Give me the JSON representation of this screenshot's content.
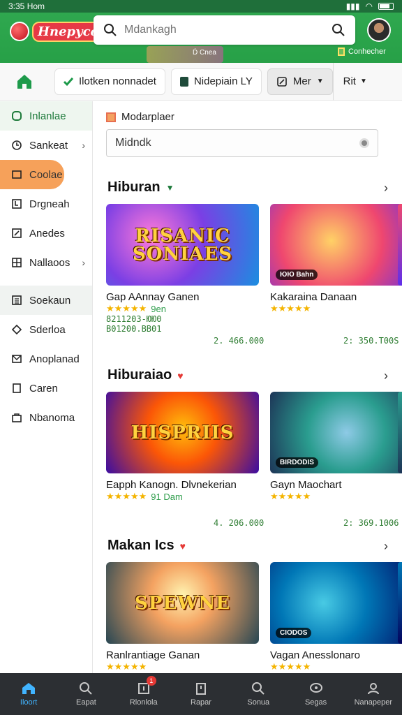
{
  "status_bar": {
    "time": "3:35 Hom"
  },
  "header": {
    "logo_text": "Hnepycop",
    "search_placeholder": "Mdankagh",
    "sub_left": "Ḋ Cnea",
    "sub_right": "Conhecher"
  },
  "topnav": {
    "pill1": "Ilotken nonnadet",
    "pill2": "Nidepiain  LY",
    "pill3": "Mer",
    "pill4": "Rit"
  },
  "sidebar": {
    "items": [
      {
        "label": "Inlanlae",
        "icon": "circle-icon",
        "state": "active"
      },
      {
        "label": "Sankeat",
        "icon": "clock-icon",
        "has_arrow": true
      },
      {
        "label": "Coolae",
        "icon": "box-icon",
        "state": "highlight"
      },
      {
        "label": "Drgneah",
        "icon": "arrow-box-icon"
      },
      {
        "label": "Anedes",
        "icon": "edit-icon"
      },
      {
        "label": "Nallaoos",
        "icon": "grid-icon",
        "has_arrow": true
      },
      {
        "label": "Soekaun",
        "icon": "list-icon",
        "state": "boxed"
      },
      {
        "label": "Sderloa",
        "icon": "tag-icon"
      },
      {
        "label": "Anoplanad",
        "icon": "mail-icon"
      },
      {
        "label": "Caren",
        "icon": "page-icon"
      },
      {
        "label": "Nbanoma",
        "icon": "bag-icon"
      }
    ]
  },
  "main": {
    "promo_label": "Modarplaer",
    "search_value": "Midndk",
    "sections": [
      {
        "title": "Hiburan",
        "cards": [
          {
            "thumb_text": "RISANIC SONIAES",
            "title": "Gap AAnnay Ganen",
            "stars": "★★★★★",
            "rating_text": "9en",
            "meta1": "8211203-ЮЮ0",
            "meta2": "B01200.BB01",
            "price": "2. 466.000"
          },
          {
            "thumb_text": "",
            "badge": "ЮЮ Bahn",
            "title": "Kakaraina Danaan",
            "stars": "★★★★★",
            "rating_text": "",
            "price": "2: 350.T00S"
          }
        ]
      },
      {
        "title": "Hiburaiao",
        "cards": [
          {
            "thumb_text": "HISPRIIS",
            "title": "Eapph Kanogn. Dlvnekerian",
            "stars": "★★★★★",
            "rating_text": "91 Dam",
            "price": "4. 206.000"
          },
          {
            "thumb_text": "",
            "badge": "BIRDODIS",
            "title": "Gayn Maochart",
            "stars": "★★★★★",
            "rating_text": "",
            "price": "2: 369.1006"
          }
        ]
      },
      {
        "title": "Makan Ics",
        "cards": [
          {
            "thumb_text": "SPEWNE",
            "title": "Ranlrantiage Ganan",
            "stars": "★★★★★",
            "rating_text": ""
          },
          {
            "thumb_text": "",
            "badge": "CIODOS",
            "title": "Vagan Anesslonaro",
            "stars": "★★★★★",
            "rating_text": ""
          }
        ]
      }
    ]
  },
  "bottomnav": {
    "items": [
      {
        "label": "Iloort",
        "icon": "home-icon",
        "active": true
      },
      {
        "label": "Eapat",
        "icon": "search-icon"
      },
      {
        "label": "Rlonlola",
        "icon": "notification-icon",
        "badge": "1"
      },
      {
        "label": "Rapar",
        "icon": "clipboard-icon"
      },
      {
        "label": "Sonua",
        "icon": "magnifier-icon"
      },
      {
        "label": "Segas",
        "icon": "chat-icon"
      },
      {
        "label": "Nanapeper",
        "icon": "profile-icon"
      }
    ]
  },
  "colors": {
    "brand_green": "#2fa84f",
    "accent_orange": "#f6a15a",
    "price_green": "#2e7d32",
    "bottom_bar": "#2c2f33",
    "active_blue": "#41b4ff"
  }
}
